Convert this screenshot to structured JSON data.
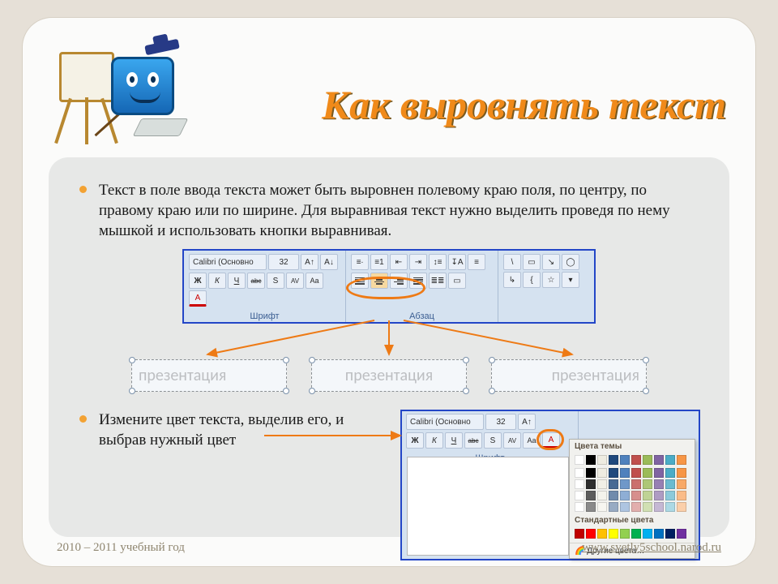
{
  "slide": {
    "title": "Как выровнять текст",
    "bullets": [
      "Текст в поле ввода текста может быть выровнен полевому краю поля, по центру, по правому краю или по ширине. Для выравнивая текст нужно выделить проведя по нему мышкой и использовать кнопки выравнивая.",
      "Измените цвет текста, выделив его, и выбрав нужный цвет"
    ]
  },
  "ribbon": {
    "font_combo": "Calibri (Основно",
    "size_combo": "32",
    "group_font": "Шрифт",
    "group_para": "Абзац",
    "bold": "Ж",
    "italic": "К",
    "underline": "Ч",
    "strike": "abc",
    "shadow": "S",
    "caps": "AV",
    "case": "Aa",
    "fontcolor": "A"
  },
  "samples": {
    "left": "презентация",
    "center": "презентация",
    "right": "презентация"
  },
  "palette": {
    "title_theme": "Цвета темы",
    "title_standard": "Стандартные цвета",
    "more": "Другие цвета…",
    "theme_colors": [
      "#ffffff",
      "#000000",
      "#eeece1",
      "#1f497d",
      "#4f81bd",
      "#c0504d",
      "#9bbb59",
      "#8064a2",
      "#4bacc6",
      "#f79646"
    ],
    "standard_colors": [
      "#c00000",
      "#ff0000",
      "#ffc000",
      "#ffff00",
      "#92d050",
      "#00b050",
      "#00b0f0",
      "#0070c0",
      "#002060",
      "#7030a0"
    ]
  },
  "footer": {
    "left": "2010 – 2011 учебный год",
    "right": "www.svetly5school.narod.ru"
  }
}
